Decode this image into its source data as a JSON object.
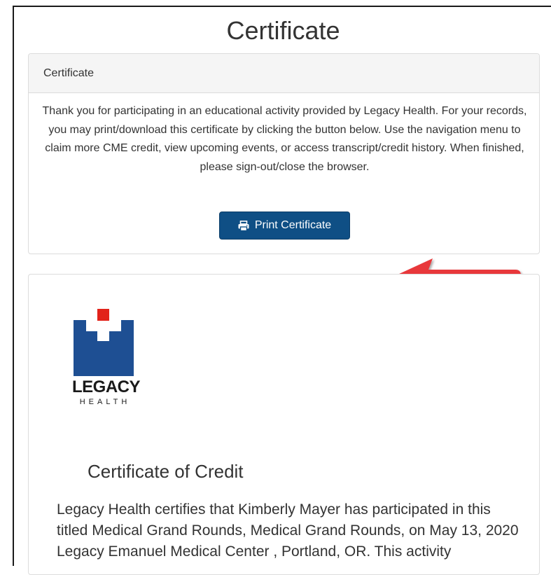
{
  "page": {
    "title": "Certificate"
  },
  "notice_panel": {
    "heading": "Certificate",
    "message": "Thank you for participating in an educational activity provided by Legacy Health. For your records, you may print/download this certificate by clicking the button below. Use the navigation menu to claim more CME credit, view upcoming events, or access transcript/credit history. When finished, please sign-out/close the browser.",
    "print_button_label": "Print Certificate",
    "print_icon": "print-icon"
  },
  "certificate": {
    "logo_text": "LEGACY",
    "logo_subtext": "HEALTH",
    "heading": "Certificate of Credit",
    "body": "Legacy Health certifies that Kimberly Mayer has participated in this titled Medical Grand Rounds, Medical Grand Rounds, on May 13, 2020 Legacy Emanuel Medical Center , Portland, OR. This activity"
  },
  "colors": {
    "button_bg": "#0f4f85",
    "arrow": "#e8373b",
    "logo_blue": "#1e4f93",
    "logo_red": "#e2231a"
  }
}
